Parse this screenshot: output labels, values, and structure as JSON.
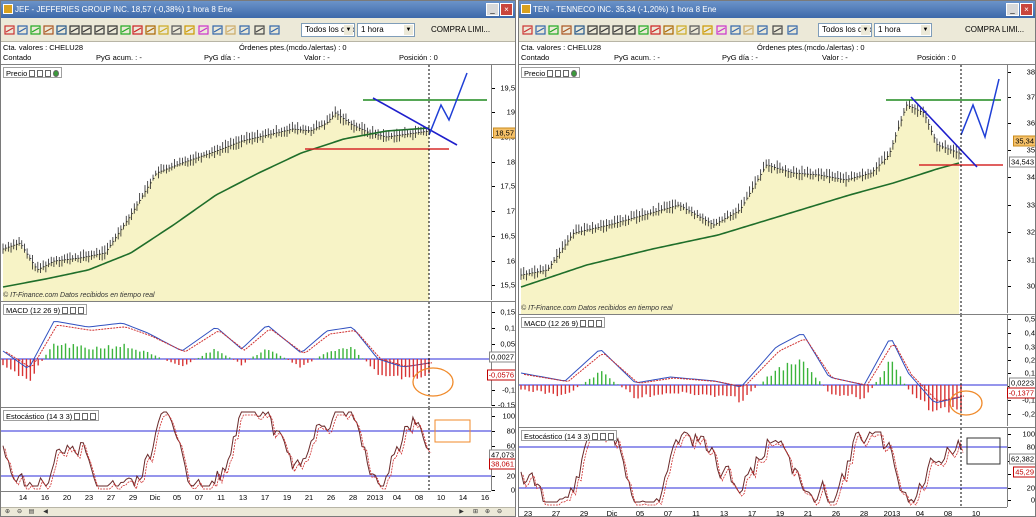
{
  "windows": [
    {
      "id": "left",
      "title": "JEF - JEFFERIES GROUP INC.   18,57 (-0,38%)   1 hora  8 Ene",
      "toolbar": {
        "data_select": "Todos los datos",
        "interval_select": "1 hora",
        "order_select": "COMPRA LIMI..."
      },
      "info": {
        "account": "Cta. valores : CHELU28",
        "orders": "Órdenes ptes.(mcdo./alertas) : 0",
        "settlement": "Contado",
        "pyg_acum": "PyG acum. : -",
        "pyg_dia": "PyG día : -",
        "valor": "Valor : -",
        "posicion": "Posición : 0"
      },
      "panels": {
        "price_label": "Precio",
        "macd_label": "MACD (12 26 9)",
        "stoch_label": "Estocástico (14 3 3)",
        "copyright": "© IT-Finance.com Datos recibidos en tiempo real"
      },
      "price_axis": {
        "ticks": [
          "19,5",
          "19",
          "18,5",
          "18",
          "17,5",
          "17",
          "16,5",
          "16",
          "15,5"
        ],
        "badges": [
          "18,57"
        ]
      },
      "macd_axis": {
        "ticks": [
          "0,15",
          "0,1",
          "0,05",
          "0",
          "-0,05",
          "-0,1",
          "-0,15"
        ],
        "badges": [
          "0,0027",
          "-0,0576"
        ]
      },
      "stoch_axis": {
        "ticks": [
          "100",
          "80",
          "60",
          "40",
          "20",
          "0"
        ],
        "badges": [
          "47,073",
          "38,061"
        ]
      },
      "x_labels": [
        "14",
        "16",
        "20",
        "23",
        "27",
        "29",
        "Dic",
        "05",
        "07",
        "11",
        "13",
        "17",
        "19",
        "21",
        "26",
        "28",
        "2013",
        "04",
        "08",
        "10",
        "14",
        "16"
      ],
      "colors": {
        "area": "#f7f3c6",
        "ma": "#1f6e2a",
        "support": "#d62b2b",
        "resistance": "#1e8a1e",
        "trend": "#1f1fcc",
        "projection": "#1f3fd6",
        "annotation": "#f08a2a"
      }
    },
    {
      "id": "right",
      "title": "TEN - TENNECO INC.   35,34 (-1,20%)   1 hora  8 Ene",
      "toolbar": {
        "data_select": "Todos los datos",
        "interval_select": "1 hora",
        "order_select": "COMPRA LIMI..."
      },
      "info": {
        "account": "Cta. valores : CHELU28",
        "orders": "Órdenes ptes.(mcdo./alertas) : 0",
        "settlement": "Contado",
        "pyg_acum": "PyG acum. : -",
        "pyg_dia": "PyG día : -",
        "valor": "Valor : -",
        "posicion": "Posición : 0"
      },
      "panels": {
        "price_label": "Precio",
        "macd_label": "MACD (12 26 9)",
        "stoch_label": "Estocástico (14 3 3)",
        "copyright": "© IT-Finance.com Datos recibidos en tiempo real"
      },
      "price_axis": {
        "ticks": [
          "38",
          "37",
          "36",
          "35",
          "34",
          "33",
          "32",
          "31",
          "30"
        ],
        "badges": [
          "35,34",
          "34,543"
        ]
      },
      "macd_axis": {
        "ticks": [
          "0,5",
          "0,4",
          "0,3",
          "0,2",
          "0,1",
          "0",
          "-0,1",
          "-0,2"
        ],
        "badges": [
          "0,0223",
          "-0,1377"
        ]
      },
      "stoch_axis": {
        "ticks": [
          "100",
          "80",
          "60",
          "40",
          "20",
          "0"
        ],
        "badges": [
          "62,382",
          "45,29"
        ]
      },
      "x_labels": [
        "23",
        "27",
        "29",
        "Dic",
        "05",
        "07",
        "11",
        "13",
        "17",
        "19",
        "21",
        "26",
        "28",
        "2013",
        "04",
        "08",
        "10"
      ],
      "colors": {
        "area": "#f7f3c6",
        "ma": "#1f6e2a",
        "support": "#d62b2b",
        "resistance": "#1e8a1e",
        "trend": "#1f1fcc",
        "projection": "#1f3fd6",
        "annotation": "#f08a2a"
      }
    }
  ]
}
